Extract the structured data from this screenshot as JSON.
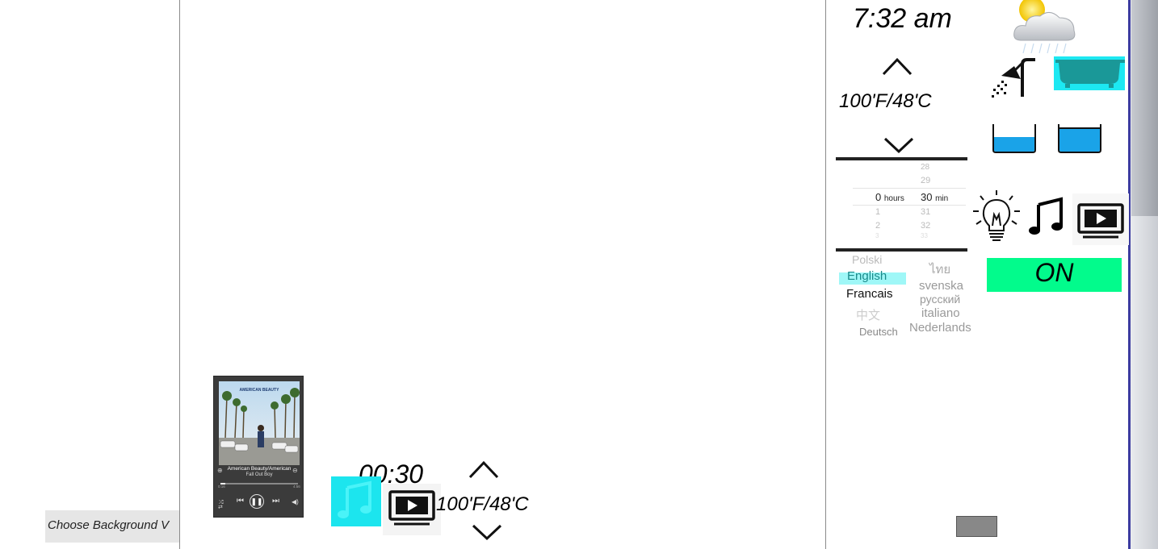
{
  "sidebar": {
    "choose_background": "Choose Background  V"
  },
  "player": {
    "album_art_text": "AMERICAN BEAUTY",
    "track_title": "American Beauty/American",
    "artist": "Fall Out Boy",
    "elapsed": "0:16",
    "duration": "4:56",
    "progress": 0.06
  },
  "bottom": {
    "timer": "00:30",
    "temperature": "100'F/48'C"
  },
  "status": {
    "clock": "7:32 am"
  },
  "thermostat": {
    "temperature": "100'F/48'C"
  },
  "picker": {
    "hours": [
      "0",
      "1",
      "2",
      "3"
    ],
    "hours_unit": "hours",
    "minutes": [
      "28",
      "29",
      "30",
      "31",
      "32",
      "33"
    ],
    "minutes_unit": "min"
  },
  "languages": {
    "polski": "Polski",
    "english": "English",
    "francais": "Francais",
    "chinese": "中文",
    "deutsch": "Deutsch",
    "thai": "ไทย",
    "svenska": "svenska",
    "russian": "русский",
    "italiano": "italiano",
    "nederlands": "Nederlands"
  },
  "controls": {
    "on_label": "ON"
  },
  "colors": {
    "cyan": "#1ce5ee",
    "on_green": "#02fb8c",
    "water_blue": "#1aa3e8",
    "tub_teal": "#1a9898",
    "highlight": "#9ff7f7"
  },
  "icons": {
    "weather": "partly-cloudy-rain-icon",
    "shower": "shower-icon",
    "bathtub": "bathtub-icon",
    "bucket": "water-bucket-icon",
    "bulb": "light-bulb-icon",
    "music": "music-note-icon",
    "tv": "tv-play-icon",
    "up": "chevron-up-icon",
    "down": "chevron-down-icon"
  }
}
